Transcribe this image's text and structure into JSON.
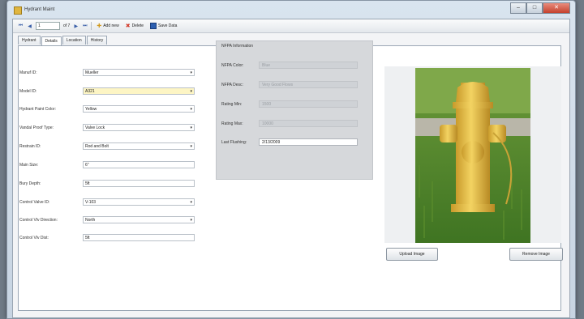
{
  "window": {
    "title": "Hydrant Maint"
  },
  "toolbar": {
    "first": "⏮",
    "prev": "◀",
    "position": "1",
    "of": "of 7",
    "next": "▶",
    "last": "⏭",
    "add_label": "Add new",
    "delete_label": "Delete",
    "save_label": "Save Data"
  },
  "tabs": [
    "Hydrant",
    "Details",
    "Location",
    "History"
  ],
  "details": [
    {
      "label": "Manuf ID:",
      "value": "Mueller",
      "dropdown": true
    },
    {
      "label": "Model ID:",
      "value": "A321",
      "dropdown": true,
      "highlight": true
    },
    {
      "label": "Hydrant Paint Color:",
      "value": "Yellow",
      "dropdown": true
    },
    {
      "label": "Vandal Proof Type:",
      "value": "Valve Lock",
      "dropdown": true
    },
    {
      "label": "Restrain ID:",
      "value": "Rod and Bolt",
      "dropdown": true
    },
    {
      "label": "Main Size:",
      "value": "6\"",
      "dropdown": false
    },
    {
      "label": "Bury Depth:",
      "value": "5ft",
      "dropdown": false
    },
    {
      "label": "Control Valve ID:",
      "value": "V-103",
      "dropdown": true
    },
    {
      "label": "Control Vlv Direction:",
      "value": "North",
      "dropdown": true
    },
    {
      "label": "Control Vlv Dist:",
      "value": "5ft",
      "dropdown": false
    }
  ],
  "nfpa": {
    "title": "NFPA Information",
    "rows": [
      {
        "label": "NFPA Color:",
        "value": "Blue",
        "enabled": false
      },
      {
        "label": "NFPA Desc:",
        "value": "Very Good Flows",
        "enabled": false
      },
      {
        "label": "Rating Min:",
        "value": "1500",
        "enabled": false
      },
      {
        "label": "Rating Max:",
        "value": "10000",
        "enabled": false
      },
      {
        "label": "Last Flushing:",
        "value": "2/13/2009",
        "enabled": true
      }
    ]
  },
  "image_buttons": {
    "upload": "Upload Image",
    "remove": "Remove Image"
  },
  "colors": {
    "hydrant": "#e8c24a",
    "grass": "#4f8a2c",
    "panel": "#d6d8db"
  }
}
